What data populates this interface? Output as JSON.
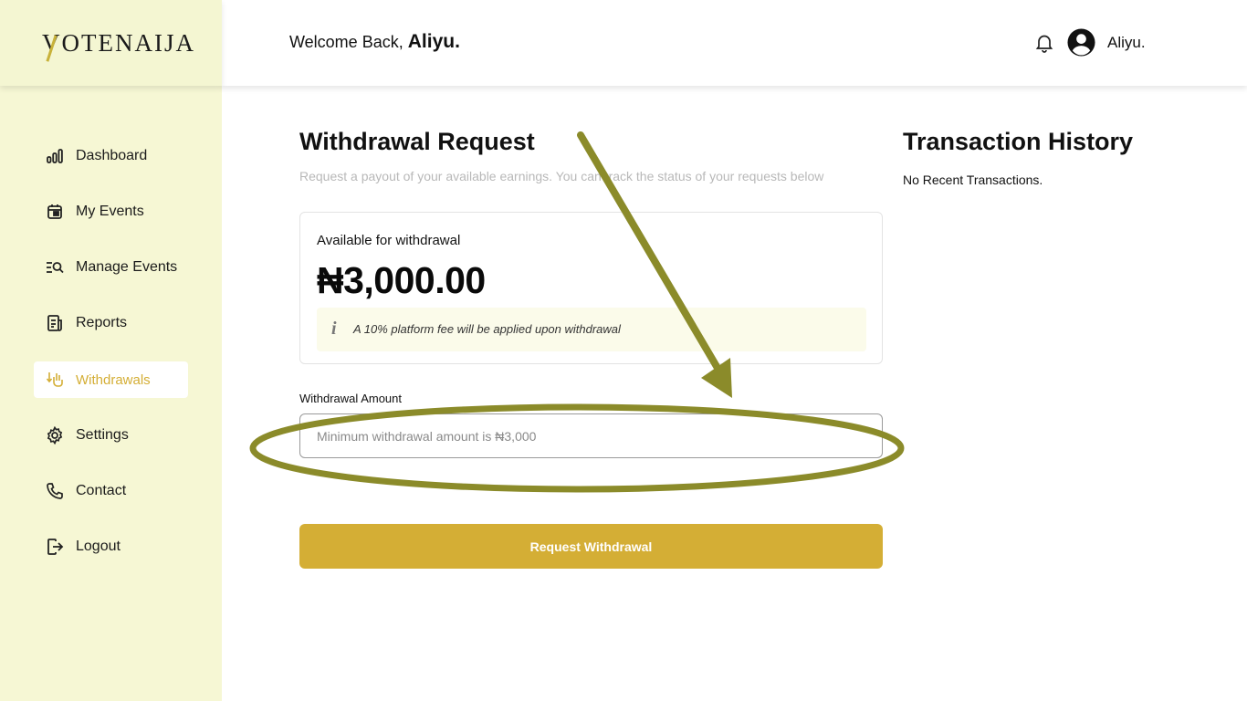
{
  "app": {
    "logo_text": "OTENAIJA",
    "logo_initial": "V"
  },
  "header": {
    "welcome_prefix": "Welcome Back,",
    "welcome_name": "Aliyu.",
    "user_name": "Aliyu."
  },
  "sidebar": {
    "items": [
      {
        "label": "Dashboard",
        "icon": "bar-chart-icon",
        "active": false
      },
      {
        "label": "My Events",
        "icon": "calendar-icon",
        "active": false
      },
      {
        "label": "Manage Events",
        "icon": "list-search-icon",
        "active": false
      },
      {
        "label": "Reports",
        "icon": "report-icon",
        "active": false
      },
      {
        "label": "Withdrawals",
        "icon": "withdraw-icon",
        "active": true
      },
      {
        "label": "Settings",
        "icon": "gear-icon",
        "active": false
      },
      {
        "label": "Contact",
        "icon": "phone-icon",
        "active": false
      },
      {
        "label": "Logout",
        "icon": "logout-icon",
        "active": false
      }
    ]
  },
  "main": {
    "title": "Withdrawal Request",
    "subtitle": "Request a payout of your available earnings. You can track the status of your requests below",
    "card": {
      "label": "Available for withdrawal",
      "amount": "₦3,000.00",
      "fee_icon": "i",
      "fee_note": "A 10% platform fee will be applied upon withdrawal"
    },
    "field_label": "Withdrawal Amount",
    "field_placeholder": "Minimum withdrawal amount is ₦3,000",
    "button_label": "Request Withdrawal"
  },
  "history": {
    "title": "Transaction History",
    "empty_text": "No Recent Transactions."
  },
  "colors": {
    "accent": "#d4ae35",
    "sidebar_bg": "#f6f7d4",
    "annotation": "#8b8b2a"
  }
}
